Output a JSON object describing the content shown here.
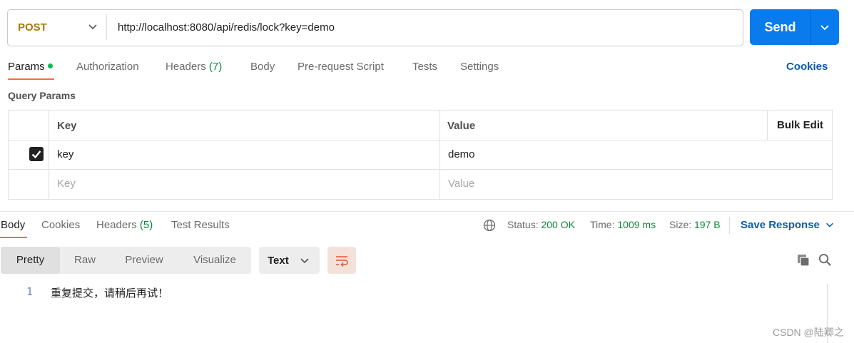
{
  "request": {
    "method": "POST",
    "url": "http://localhost:8080/api/redis/lock?key=demo",
    "send_label": "Send"
  },
  "request_tabs": [
    {
      "label": "Params",
      "active": true
    },
    {
      "label": "Authorization"
    },
    {
      "label": "Headers",
      "count": "(7)"
    },
    {
      "label": "Body"
    },
    {
      "label": "Pre-request Script"
    },
    {
      "label": "Tests"
    },
    {
      "label": "Settings"
    }
  ],
  "cookies_label": "Cookies",
  "query_params": {
    "title": "Query Params",
    "columns": {
      "key": "Key",
      "value": "Value",
      "bulk_edit": "Bulk Edit"
    },
    "rows": [
      {
        "checked": true,
        "key": "key",
        "value": "demo"
      }
    ],
    "placeholder": {
      "key": "Key",
      "value": "Value"
    }
  },
  "response_tabs": [
    {
      "label": "Body",
      "active": true
    },
    {
      "label": "Cookies"
    },
    {
      "label": "Headers",
      "count": "(5)"
    },
    {
      "label": "Test Results"
    }
  ],
  "response_status": {
    "status_label": "Status:",
    "status_value": "200 OK",
    "time_label": "Time:",
    "time_value": "1009 ms",
    "size_label": "Size:",
    "size_value": "197 B",
    "save_label": "Save Response"
  },
  "view_modes": [
    {
      "label": "Pretty",
      "active": true
    },
    {
      "label": "Raw"
    },
    {
      "label": "Preview"
    },
    {
      "label": "Visualize"
    }
  ],
  "format_select": "Text",
  "response_body": [
    {
      "line": "1",
      "text": "重复提交，请稍后再试！"
    }
  ],
  "watermark": "CSDN @陆卿之",
  "colors": {
    "accent_orange": "#ff6c37",
    "send_blue": "#097bed",
    "link_blue": "#0b5cad",
    "success_green": "#0a8a3a",
    "method_post": "#a77b10"
  },
  "icons": [
    "chevron-down-icon",
    "checkbox-checked-icon",
    "globe-icon",
    "word-wrap-icon",
    "copy-icon",
    "search-icon"
  ]
}
